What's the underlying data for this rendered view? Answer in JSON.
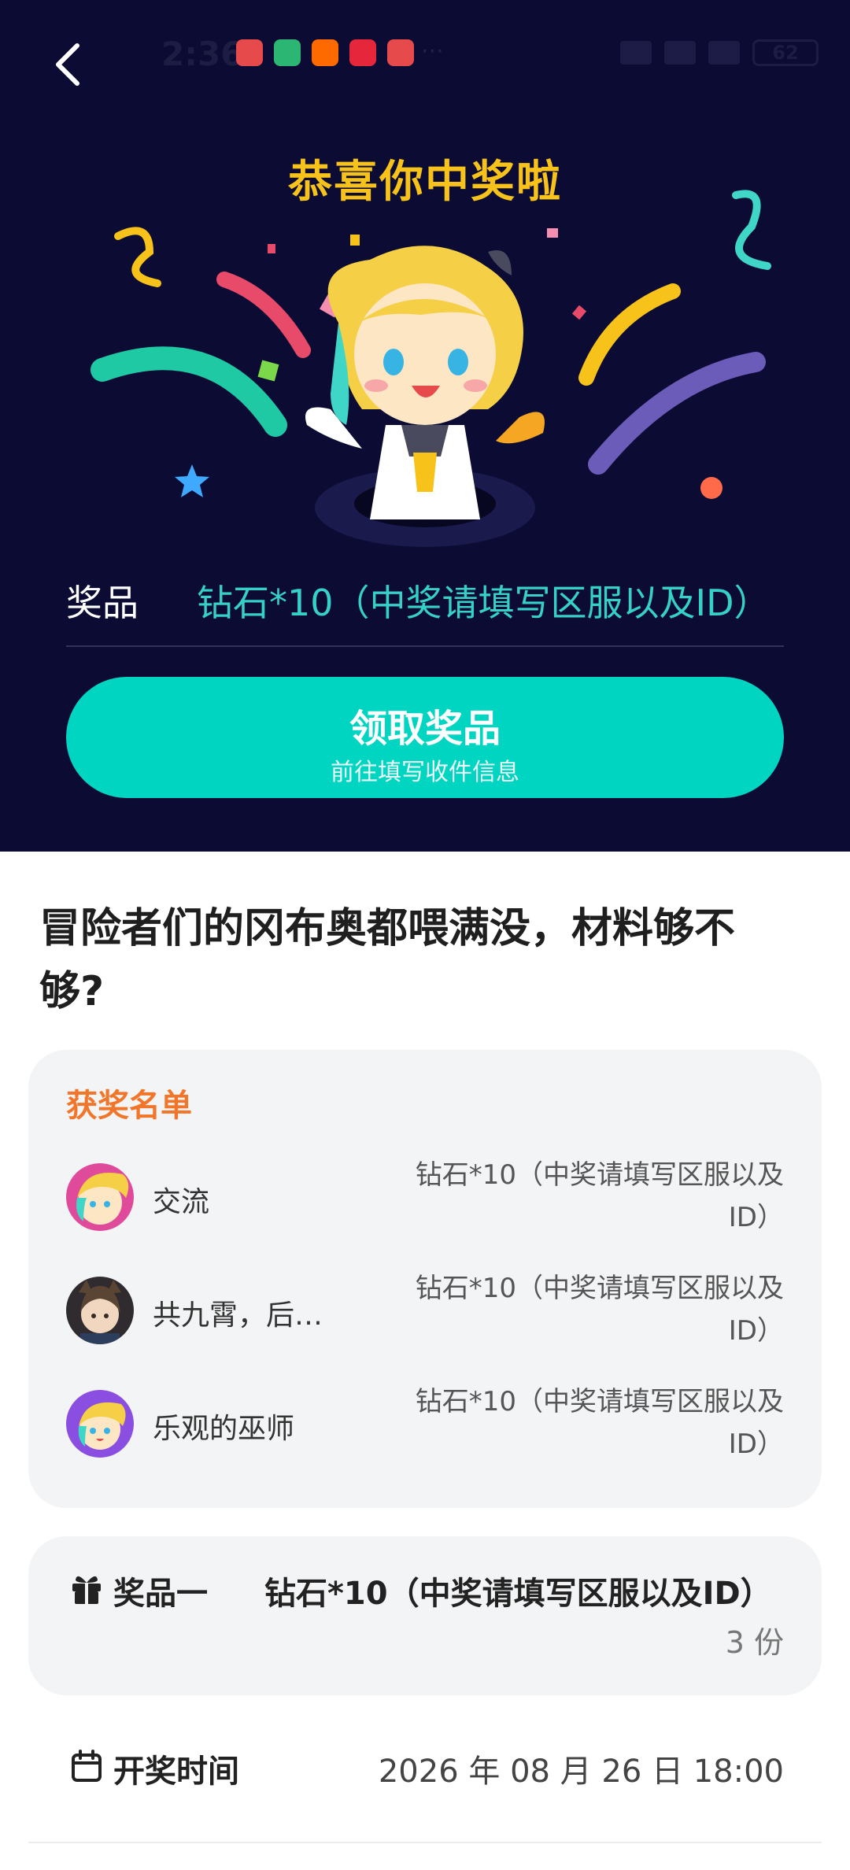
{
  "status_bar": {
    "time": "2:36",
    "more": "···",
    "battery": "62"
  },
  "hero": {
    "headline": "恭喜你中奖啦",
    "prize_label": "奖品",
    "prize_value": "钻石*10（中奖请填写区服以及ID）",
    "claim_button": {
      "title": "领取奖品",
      "subtitle": "前往填写收件信息"
    }
  },
  "post": {
    "title": "冒险者们的冈布奥都喂满没，材料够不够?"
  },
  "winners": {
    "title": "获奖名单",
    "items": [
      {
        "name": "交流",
        "prize": "钻石*10（中奖请填写区服以及ID）"
      },
      {
        "name": "共九霄，后…",
        "prize": "钻石*10（中奖请填写区服以及ID）"
      },
      {
        "name": "乐观的巫师",
        "prize": "钻石*10（中奖请填写区服以及ID）"
      }
    ]
  },
  "prize_one": {
    "label": "奖品一",
    "value": "钻石*10（中奖请填写区服以及ID）",
    "count": "3 份"
  },
  "draw_time": {
    "label": "开奖时间",
    "value": "2026 年 08 月 26 日 18:00"
  },
  "colors": {
    "hero_bg": "#0b0b33",
    "accent_teal": "#00d5c2",
    "headline_yellow": "#f7c21a",
    "winners_orange": "#f2762a"
  }
}
